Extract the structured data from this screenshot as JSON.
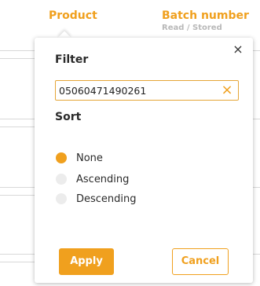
{
  "columns": {
    "product_label": "Product",
    "batch_label": "Batch number",
    "batch_sublabel": "Read / Stored"
  },
  "filter_popover": {
    "filter_title": "Filter",
    "filter_value": "05060471490261",
    "sort_title": "Sort",
    "sort_options": [
      {
        "label": "None",
        "selected": true
      },
      {
        "label": "Ascending",
        "selected": false
      },
      {
        "label": "Descending",
        "selected": false
      }
    ],
    "apply_label": "Apply",
    "cancel_label": "Cancel",
    "close_symbol": "×",
    "clear_symbol": "×"
  },
  "colors": {
    "accent": "#f0a01e",
    "muted": "#b9b9b9"
  },
  "icons": {
    "close": "close-icon",
    "clear": "clear-icon"
  }
}
